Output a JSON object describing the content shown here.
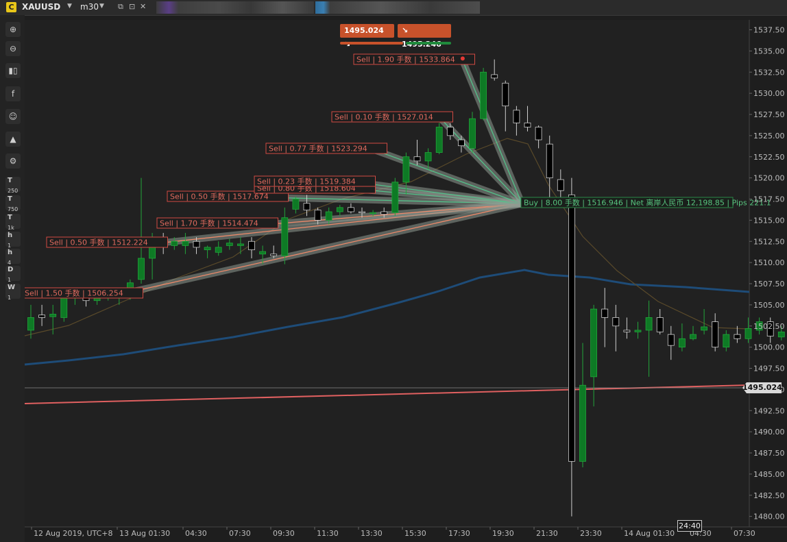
{
  "tabs": {
    "symbol_icon": "C",
    "symbol": "XAUUSD",
    "timeframe": "m30"
  },
  "toolbar": {
    "icons": [
      "zoom-in-icon",
      "zoom-out-icon",
      "candles-icon",
      "facebook-icon",
      "robot-icon",
      "objects-icon",
      "settings-chart-icon"
    ],
    "timeframes": [
      {
        "main": "T",
        "sub": "250"
      },
      {
        "main": "T",
        "sub": "750"
      },
      {
        "main": "T",
        "sub": "1k"
      },
      {
        "main": "h",
        "sub": "1"
      },
      {
        "main": "h",
        "sub": "4"
      },
      {
        "main": "D",
        "sub": "1"
      },
      {
        "main": "W",
        "sub": "1"
      }
    ]
  },
  "header_prices": {
    "bid": "1495.024",
    "ask": "1495.246"
  },
  "current_price_label": "1495.024",
  "countdown": "24:40",
  "chart_data": {
    "type": "candlestick",
    "symbol": "XAUUSD",
    "timeframe": "m30",
    "ylim": [
      1478.5,
      1538.5
    ],
    "y_ticks": [
      "1537.50",
      "1535.00",
      "1532.50",
      "1530.00",
      "1527.50",
      "1525.00",
      "1522.50",
      "1520.00",
      "1517.50",
      "1515.00",
      "1512.50",
      "1510.00",
      "1507.50",
      "1505.00",
      "1502.50",
      "1500.00",
      "1497.50",
      "1495.00",
      "1492.50",
      "1490.00",
      "1487.50",
      "1485.00",
      "1482.50",
      "1480.00"
    ],
    "x_ticks": [
      "12 Aug 2019, UTC+8",
      "13 Aug 01:30",
      "04:30",
      "07:30",
      "09:30",
      "11:30",
      "13:30",
      "15:30",
      "17:30",
      "19:30",
      "21:30",
      "23:30",
      "14 Aug 01:30",
      "04:30",
      "07:30"
    ],
    "candles": [
      {
        "o": 1502.0,
        "h": 1505.0,
        "l": 1501.0,
        "c": 1503.5
      },
      {
        "o": 1503.8,
        "h": 1505.0,
        "l": 1502.5,
        "c": 1503.5
      },
      {
        "o": 1503.6,
        "h": 1505.0,
        "l": 1501.5,
        "c": 1503.9
      },
      {
        "o": 1503.5,
        "h": 1507.0,
        "l": 1503.0,
        "c": 1506.5
      },
      {
        "o": 1506.0,
        "h": 1507.0,
        "l": 1505.0,
        "c": 1506.2
      },
      {
        "o": 1506.0,
        "h": 1506.5,
        "l": 1504.8,
        "c": 1505.5
      },
      {
        "o": 1505.5,
        "h": 1506.5,
        "l": 1505.0,
        "c": 1506.0
      },
      {
        "o": 1506.0,
        "h": 1506.8,
        "l": 1505.5,
        "c": 1506.3
      },
      {
        "o": 1506.0,
        "h": 1506.5,
        "l": 1505.0,
        "c": 1506.4
      },
      {
        "o": 1506.0,
        "h": 1508.0,
        "l": 1505.6,
        "c": 1507.6
      },
      {
        "o": 1508.0,
        "h": 1520.0,
        "l": 1507.5,
        "c": 1510.5
      },
      {
        "o": 1510.5,
        "h": 1513.5,
        "l": 1508.0,
        "c": 1512.5
      },
      {
        "o": 1512.5,
        "h": 1513.5,
        "l": 1511.0,
        "c": 1512.0
      },
      {
        "o": 1512.0,
        "h": 1513.0,
        "l": 1511.5,
        "c": 1512.5
      },
      {
        "o": 1512.0,
        "h": 1513.5,
        "l": 1511.0,
        "c": 1512.5
      },
      {
        "o": 1512.5,
        "h": 1513.0,
        "l": 1511.0,
        "c": 1511.8
      },
      {
        "o": 1511.5,
        "h": 1512.0,
        "l": 1510.5,
        "c": 1511.8
      },
      {
        "o": 1511.2,
        "h": 1512.5,
        "l": 1510.8,
        "c": 1511.8
      },
      {
        "o": 1512.0,
        "h": 1512.8,
        "l": 1511.5,
        "c": 1512.3
      },
      {
        "o": 1512.0,
        "h": 1513.0,
        "l": 1511.0,
        "c": 1512.2
      },
      {
        "o": 1512.5,
        "h": 1513.0,
        "l": 1510.5,
        "c": 1511.5
      },
      {
        "o": 1511.0,
        "h": 1512.0,
        "l": 1509.8,
        "c": 1511.3
      },
      {
        "o": 1511.0,
        "h": 1512.0,
        "l": 1510.5,
        "c": 1510.8
      },
      {
        "o": 1510.8,
        "h": 1516.5,
        "l": 1509.8,
        "c": 1515.3
      },
      {
        "o": 1516.3,
        "h": 1517.8,
        "l": 1515.8,
        "c": 1517.5
      },
      {
        "o": 1517.0,
        "h": 1518.0,
        "l": 1515.5,
        "c": 1516.2
      },
      {
        "o": 1516.2,
        "h": 1516.5,
        "l": 1514.5,
        "c": 1515.0
      },
      {
        "o": 1515.0,
        "h": 1516.5,
        "l": 1514.5,
        "c": 1516.0
      },
      {
        "o": 1516.0,
        "h": 1516.8,
        "l": 1515.5,
        "c": 1516.5
      },
      {
        "o": 1516.5,
        "h": 1517.0,
        "l": 1515.8,
        "c": 1516.0
      },
      {
        "o": 1516.0,
        "h": 1516.5,
        "l": 1515.3,
        "c": 1515.9
      },
      {
        "o": 1515.8,
        "h": 1516.2,
        "l": 1515.5,
        "c": 1515.9
      },
      {
        "o": 1516.0,
        "h": 1516.5,
        "l": 1515.3,
        "c": 1515.7
      },
      {
        "o": 1515.9,
        "h": 1520.0,
        "l": 1515.5,
        "c": 1519.5
      },
      {
        "o": 1519.5,
        "h": 1523.0,
        "l": 1518.0,
        "c": 1522.5
      },
      {
        "o": 1522.5,
        "h": 1524.5,
        "l": 1521.5,
        "c": 1522.0
      },
      {
        "o": 1522.0,
        "h": 1523.5,
        "l": 1521.0,
        "c": 1523.0
      },
      {
        "o": 1523.0,
        "h": 1526.5,
        "l": 1522.8,
        "c": 1526.0
      },
      {
        "o": 1526.0,
        "h": 1526.5,
        "l": 1524.5,
        "c": 1525.0
      },
      {
        "o": 1524.5,
        "h": 1525.0,
        "l": 1523.0,
        "c": 1523.8
      },
      {
        "o": 1523.5,
        "h": 1527.8,
        "l": 1523.0,
        "c": 1527.0
      },
      {
        "o": 1527.0,
        "h": 1533.0,
        "l": 1526.8,
        "c": 1532.5
      },
      {
        "o": 1532.2,
        "h": 1534.0,
        "l": 1531.5,
        "c": 1531.8
      },
      {
        "o": 1531.2,
        "h": 1531.5,
        "l": 1525.5,
        "c": 1528.5
      },
      {
        "o": 1528.0,
        "h": 1528.5,
        "l": 1525.0,
        "c": 1526.5
      },
      {
        "o": 1526.5,
        "h": 1528.5,
        "l": 1525.5,
        "c": 1526.0
      },
      {
        "o": 1526.0,
        "h": 1526.2,
        "l": 1523.5,
        "c": 1524.5
      },
      {
        "o": 1524.0,
        "h": 1525.0,
        "l": 1517.5,
        "c": 1520.0
      },
      {
        "o": 1519.8,
        "h": 1521.0,
        "l": 1516.5,
        "c": 1518.5
      },
      {
        "o": 1518.0,
        "h": 1520.0,
        "l": 1480.0,
        "c": 1486.5
      },
      {
        "o": 1486.5,
        "h": 1500.5,
        "l": 1485.8,
        "c": 1495.5
      },
      {
        "o": 1496.5,
        "h": 1505.0,
        "l": 1493.0,
        "c": 1504.5
      },
      {
        "o": 1504.5,
        "h": 1507.0,
        "l": 1500.0,
        "c": 1503.5
      },
      {
        "o": 1503.5,
        "h": 1505.0,
        "l": 1499.5,
        "c": 1502.5
      },
      {
        "o": 1502.0,
        "h": 1503.5,
        "l": 1501.0,
        "c": 1501.8
      },
      {
        "o": 1501.8,
        "h": 1503.0,
        "l": 1501.0,
        "c": 1502.0
      },
      {
        "o": 1502.0,
        "h": 1505.5,
        "l": 1496.5,
        "c": 1503.5
      },
      {
        "o": 1503.5,
        "h": 1504.5,
        "l": 1501.5,
        "c": 1501.8
      },
      {
        "o": 1501.5,
        "h": 1502.5,
        "l": 1498.5,
        "c": 1500.2
      },
      {
        "o": 1500.0,
        "h": 1502.8,
        "l": 1499.5,
        "c": 1501.0
      },
      {
        "o": 1501.0,
        "h": 1502.5,
        "l": 1500.8,
        "c": 1501.5
      },
      {
        "o": 1502.0,
        "h": 1504.5,
        "l": 1501.5,
        "c": 1502.4
      },
      {
        "o": 1503.0,
        "h": 1504.0,
        "l": 1499.5,
        "c": 1500.0
      },
      {
        "o": 1500.0,
        "h": 1502.0,
        "l": 1499.5,
        "c": 1501.5
      },
      {
        "o": 1501.5,
        "h": 1502.5,
        "l": 1500.5,
        "c": 1501.0
      },
      {
        "o": 1501.0,
        "h": 1503.5,
        "l": 1500.5,
        "c": 1502.2
      },
      {
        "o": 1502.0,
        "h": 1503.5,
        "l": 1501.5,
        "c": 1503.0
      },
      {
        "o": 1503.0,
        "h": 1503.5,
        "l": 1500.5,
        "c": 1501.3
      },
      {
        "o": 1501.2,
        "h": 1502.5,
        "l": 1500.8,
        "c": 1501.8
      }
    ],
    "trades": [
      {
        "label": "Sell",
        "lots": "1.50 手数",
        "price": "1506.254",
        "bar": 8
      },
      {
        "label": "Sell",
        "lots": "0.50 手数",
        "price": "1512.224",
        "bar": 11
      },
      {
        "label": "Sell",
        "lots": "1.70 手数",
        "price": "1514.474",
        "bar": 21
      },
      {
        "label": "Sell",
        "lots": "0.50 手数",
        "price": "1517.674",
        "bar": 22
      },
      {
        "label": "Sell",
        "lots": "0.80 手数",
        "price": "1518.604",
        "bar": 30
      },
      {
        "label": "Sell",
        "lots": "0.23 手数",
        "price": "1519.384",
        "bar": 30
      },
      {
        "label": "Sell",
        "lots": "0.77 手数",
        "price": "1523.294",
        "bar": 31
      },
      {
        "label": "Sell",
        "lots": "0.10 手数",
        "price": "1527.014",
        "bar": 37
      },
      {
        "label": "Sell",
        "lots": "1.90 手数",
        "price": "1533.864",
        "bar": 39
      }
    ],
    "close_point": {
      "bar": 44,
      "price": 1516.946
    },
    "summary": {
      "side": "Buy",
      "lots": "8.00 手数",
      "price": "1516.946",
      "net": "Net 离岸人民币 12,198.85",
      "pips": "Pips 221.1"
    },
    "current_price": 1495.024,
    "colors": {
      "bull": "#0e7a25",
      "bear": "#000000",
      "bear_wick": "#cfcfcf",
      "bull_wick": "#22a63b",
      "ma_slow": "#1e4c78",
      "ma_fast": "#5a4a2a",
      "trend": "#e06060",
      "sell_label": "#d24a43",
      "buy_label": "#2a8a48"
    }
  }
}
